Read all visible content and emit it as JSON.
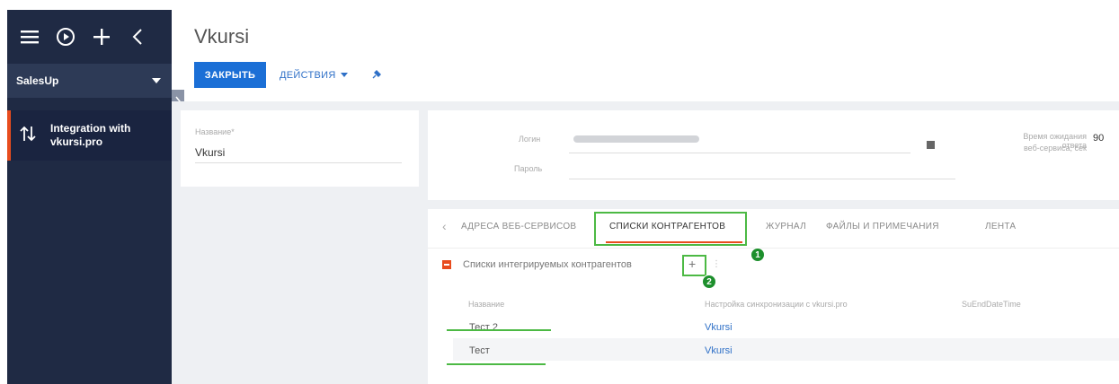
{
  "sidebar": {
    "workspace": "SalesUp",
    "nav_item": "Integration with vkursi.pro"
  },
  "header": {
    "title": "Vkursi",
    "close_label": "ЗАКРЫТЬ",
    "actions_label": "ДЕЙСТВИЯ"
  },
  "left_card": {
    "name_label": "Название*",
    "name_value": "Vkursi"
  },
  "top_card": {
    "login_label": "Логин",
    "password_label": "Пароль",
    "timeout_label_1": "Время ожидания ответа",
    "timeout_label_2": "веб-сервиса, сек",
    "timeout_value": "90"
  },
  "tabs": {
    "items": [
      "АДРЕСА ВЕБ-СЕРВИСОВ",
      "СПИСКИ КОНТРАГЕНТОВ",
      "ЖУРНАЛ",
      "ФАЙЛЫ И ПРИМЕЧАНИЯ",
      "ЛЕНТА"
    ]
  },
  "badges": [
    "1",
    "2"
  ],
  "detail": {
    "title": "Списки интегрируемых контрагентов",
    "plus": "+",
    "separator": "⋮",
    "columns": [
      "Название",
      "Настройка синхронизации с vkursi.pro",
      "SuEndDateTime"
    ],
    "rows": [
      {
        "name": "Тест 2",
        "setting": "Vkursi"
      },
      {
        "name": "Тест",
        "setting": "Vkursi"
      }
    ]
  },
  "colors": {
    "sidebar": "#1f2a44",
    "accent": "#e84c1e",
    "primary_button": "#1b6fd6",
    "annotation_green": "#4cb944"
  }
}
